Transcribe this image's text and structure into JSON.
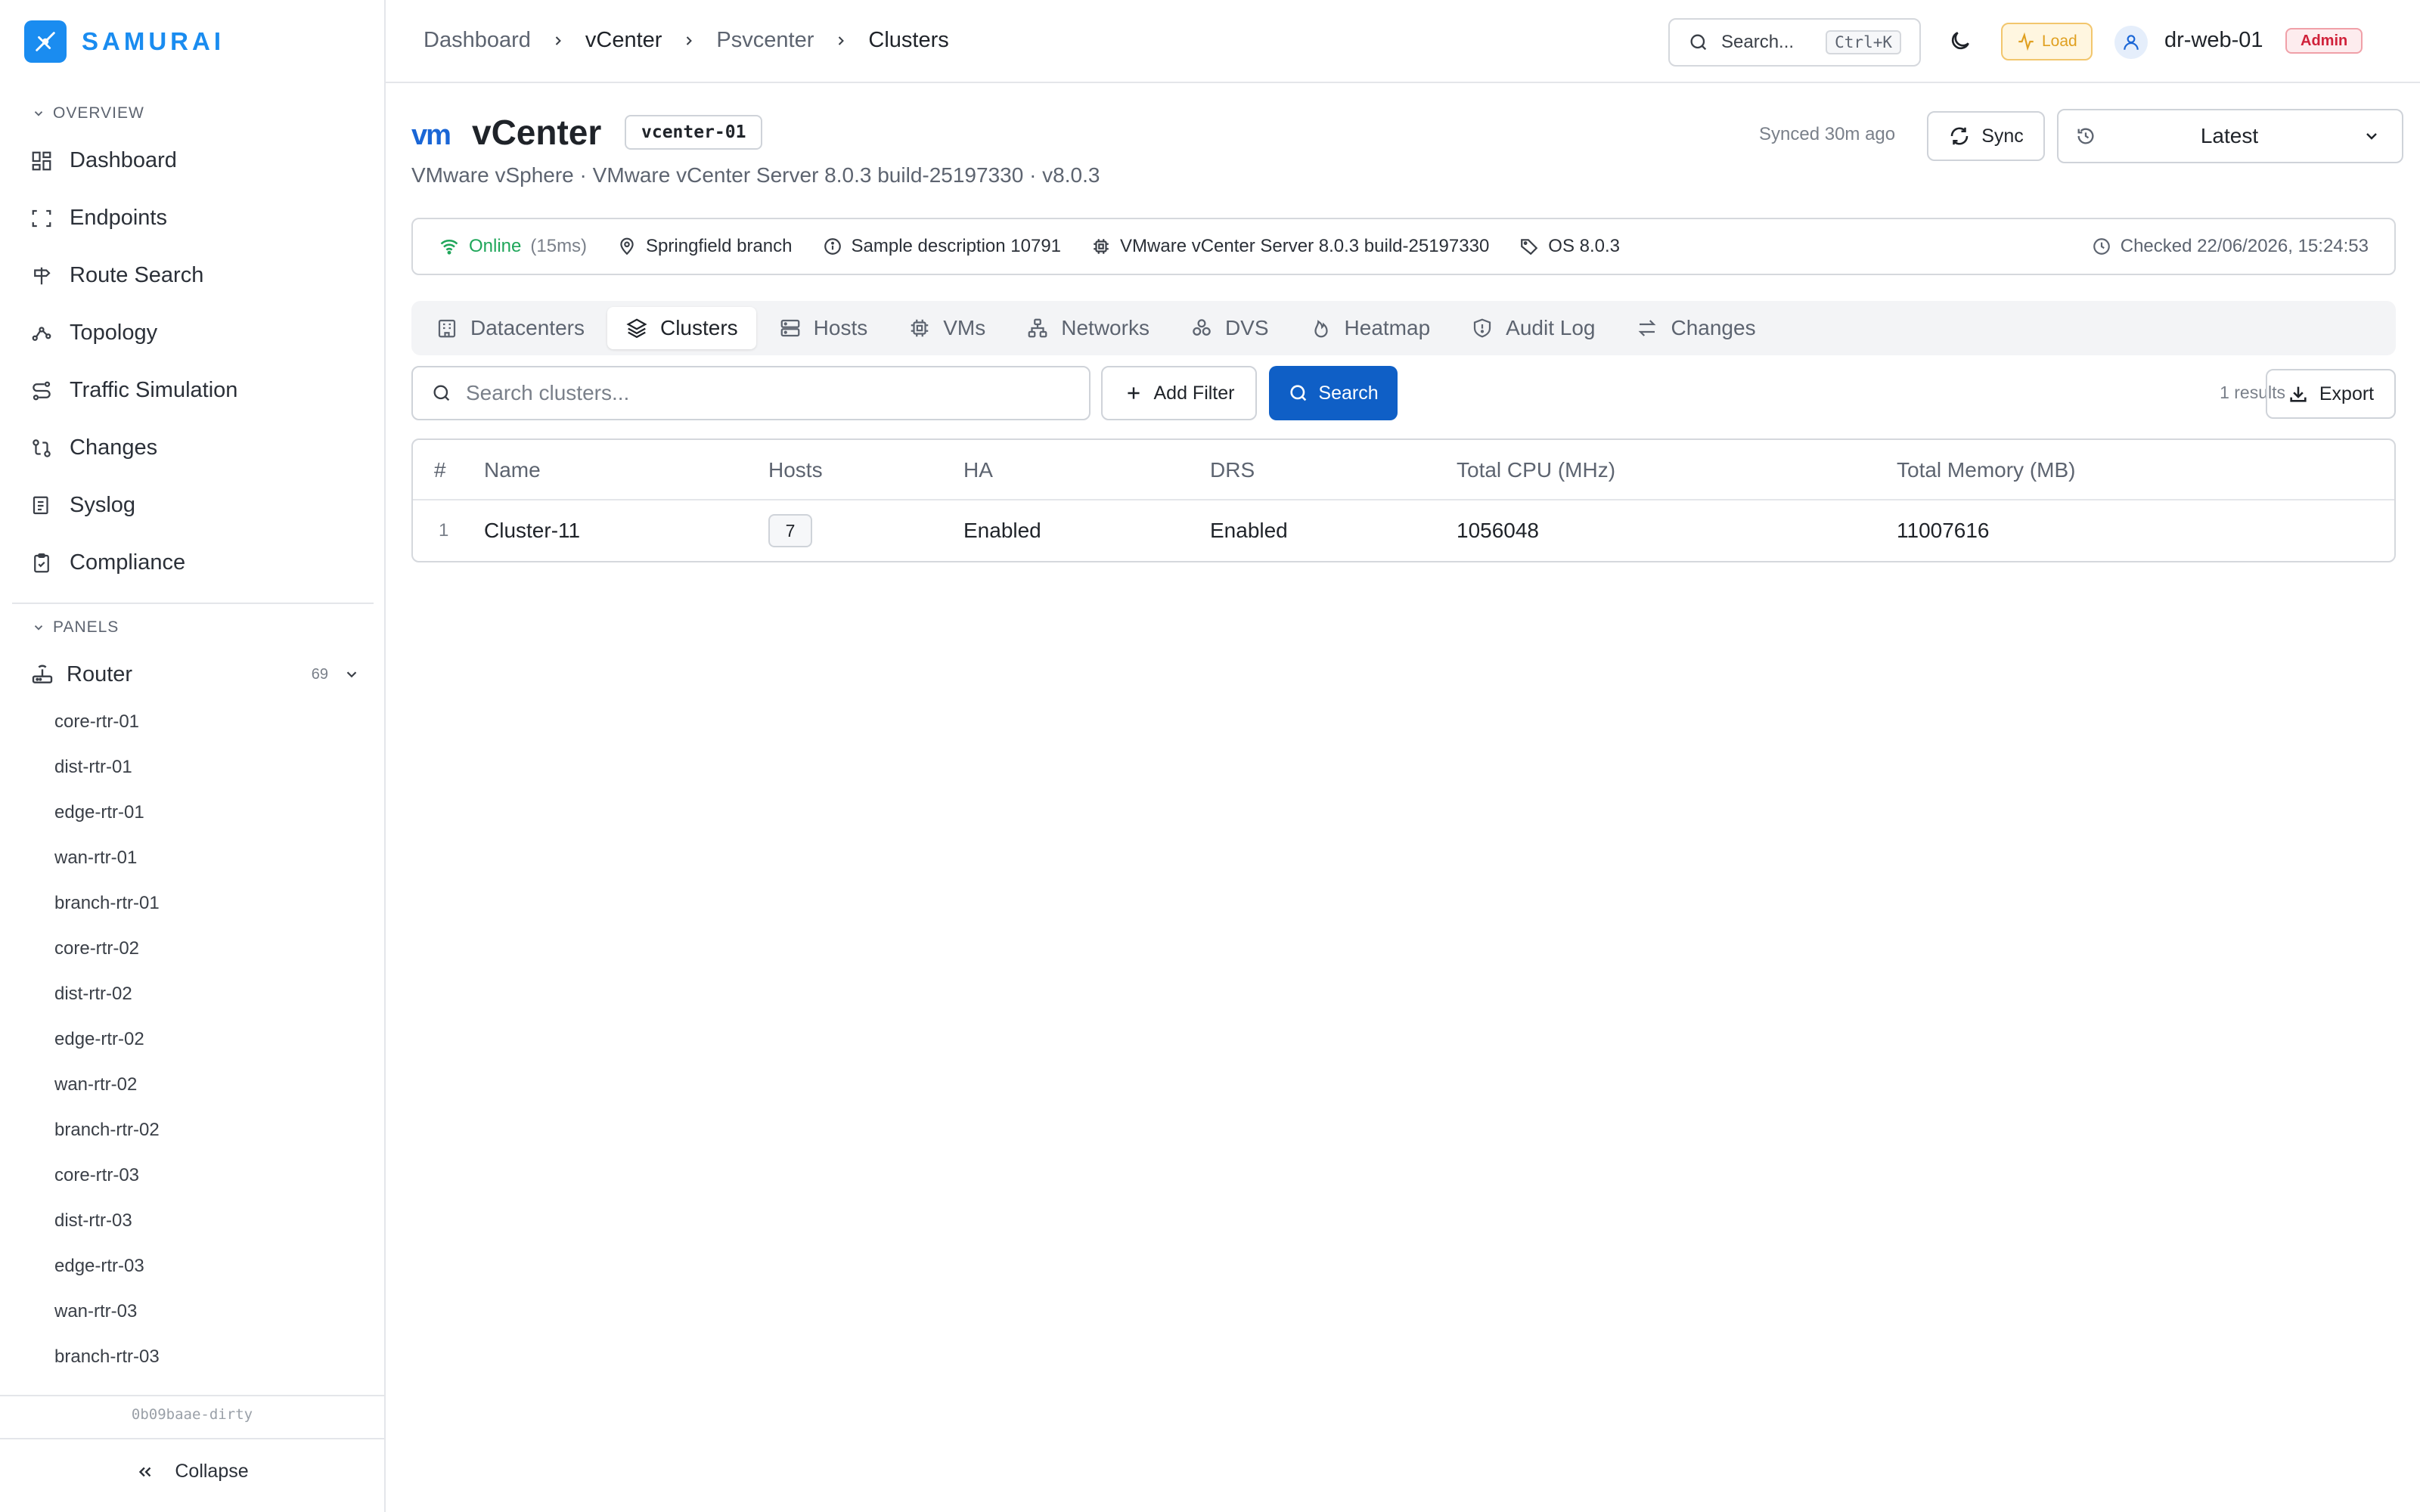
{
  "brand": {
    "name": "SAMURAI",
    "color": "#1a8cf0"
  },
  "sidebar": {
    "overview_label": "OVERVIEW",
    "items": [
      {
        "label": "Dashboard",
        "icon": "grid-icon"
      },
      {
        "label": "Endpoints",
        "icon": "scan-icon"
      },
      {
        "label": "Route Search",
        "icon": "signpost-icon"
      },
      {
        "label": "Topology",
        "icon": "topology-icon"
      },
      {
        "label": "Traffic Simulation",
        "icon": "route-icon"
      },
      {
        "label": "Changes",
        "icon": "git-compare-icon"
      },
      {
        "label": "Syslog",
        "icon": "log-icon"
      },
      {
        "label": "Compliance",
        "icon": "clipboard-check-icon"
      }
    ],
    "panels_label": "PANELS",
    "router": {
      "label": "Router",
      "count": "69"
    },
    "router_items": [
      "core-rtr-01",
      "dist-rtr-01",
      "edge-rtr-01",
      "wan-rtr-01",
      "branch-rtr-01",
      "core-rtr-02",
      "dist-rtr-02",
      "edge-rtr-02",
      "wan-rtr-02",
      "branch-rtr-02",
      "core-rtr-03",
      "dist-rtr-03",
      "edge-rtr-03",
      "wan-rtr-03",
      "branch-rtr-03"
    ],
    "commit": "0b09baae-dirty",
    "collapse_label": "Collapse"
  },
  "topbar": {
    "breadcrumbs": [
      "Dashboard",
      "vCenter",
      "Psvcenter",
      "Clusters"
    ],
    "search_placeholder": "Search...",
    "search_shortcut": "Ctrl+K",
    "load_label": "Load",
    "user": "dr-web-01",
    "role": "Admin"
  },
  "header": {
    "logo_text": "vm",
    "title": "vCenter",
    "id": "vcenter-01",
    "subtitle": "VMware vSphere · VMware vCenter Server 8.0.3 build-25197330 · v8.0.3",
    "synced": "Synced 30m ago",
    "sync_label": "Sync",
    "version_selected": "Latest"
  },
  "info": {
    "status": "Online",
    "latency": "(15ms)",
    "location": "Springfield branch",
    "description": "Sample description 10791",
    "product": "VMware vCenter Server 8.0.3 build-25197330",
    "os": "OS 8.0.3",
    "checked": "Checked 22/06/2026, 15:24:53"
  },
  "tabs": [
    {
      "label": "Datacenters",
      "icon": "building-icon"
    },
    {
      "label": "Clusters",
      "icon": "layers-icon",
      "active": true
    },
    {
      "label": "Hosts",
      "icon": "server-icon"
    },
    {
      "label": "VMs",
      "icon": "cpu-icon"
    },
    {
      "label": "Networks",
      "icon": "network-icon"
    },
    {
      "label": "DVS",
      "icon": "boxes-icon"
    },
    {
      "label": "Heatmap",
      "icon": "flame-icon"
    },
    {
      "label": "Audit Log",
      "icon": "shield-icon"
    },
    {
      "label": "Changes",
      "icon": "arrows-swap-icon"
    }
  ],
  "toolbar": {
    "search_placeholder": "Search clusters...",
    "add_filter": "Add Filter",
    "search": "Search",
    "results": "1 results",
    "export": "Export"
  },
  "table": {
    "columns": [
      "#",
      "Name",
      "Hosts",
      "HA",
      "DRS",
      "Total CPU (MHz)",
      "Total Memory (MB)"
    ],
    "rows": [
      {
        "idx": "1",
        "name": "Cluster-11",
        "hosts": "7",
        "ha": "Enabled",
        "drs": "Enabled",
        "cpu": "1056048",
        "memory": "11007616"
      }
    ]
  },
  "colors": {
    "accent": "#0f5fc6",
    "online": "#1fa65a",
    "load": "#e0a021",
    "admin": "#d0213a"
  }
}
